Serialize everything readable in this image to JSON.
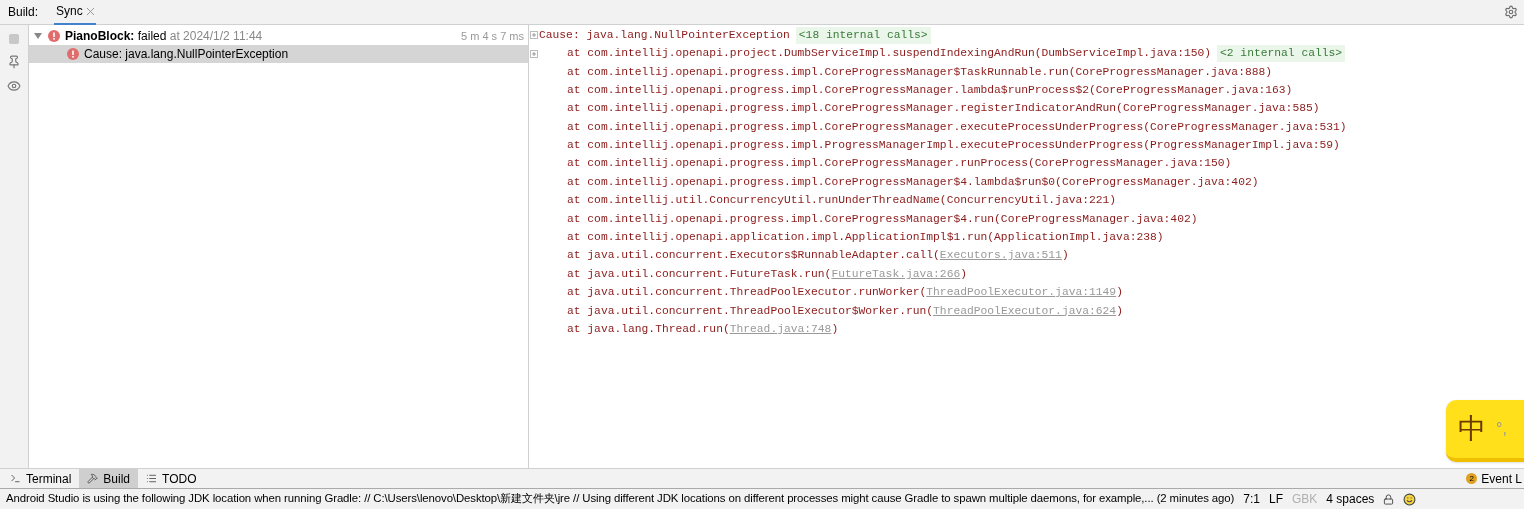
{
  "header": {
    "label": "Build:",
    "tabs": [
      {
        "label": "Sync",
        "selected": true
      }
    ]
  },
  "tree": {
    "items": [
      {
        "name": "PianoBlock:",
        "status": "failed",
        "time": "at 2024/1/2 11:44",
        "duration": "5 m 4 s 7 ms",
        "selected": false,
        "expanded": true,
        "children": [
          {
            "name": "Cause: java.lang.NullPointerException",
            "selected": true
          }
        ]
      }
    ]
  },
  "console": {
    "lines": [
      {
        "kind": "plain",
        "text": "Cause: java.lang.NullPointerException",
        "internal": "<18 internal calls>",
        "fold": true
      },
      {
        "kind": "plain",
        "text": "at com.intellij.openapi.project.DumbServiceImpl.suspendIndexingAndRun(DumbServiceImpl.java:150)",
        "internal": "<2 internal calls>",
        "fold": true
      },
      {
        "kind": "plain",
        "text": "at com.intellij.openapi.progress.impl.CoreProgressManager$TaskRunnable.run(CoreProgressManager.java:888)"
      },
      {
        "kind": "plain",
        "text": "at com.intellij.openapi.progress.impl.CoreProgressManager.lambda$runProcess$2(CoreProgressManager.java:163)"
      },
      {
        "kind": "plain",
        "text": "at com.intellij.openapi.progress.impl.CoreProgressManager.registerIndicatorAndRun(CoreProgressManager.java:585)"
      },
      {
        "kind": "plain",
        "text": "at com.intellij.openapi.progress.impl.CoreProgressManager.executeProcessUnderProgress(CoreProgressManager.java:531)"
      },
      {
        "kind": "plain",
        "text": "at com.intellij.openapi.progress.impl.ProgressManagerImpl.executeProcessUnderProgress(ProgressManagerImpl.java:59)"
      },
      {
        "kind": "plain",
        "text": "at com.intellij.openapi.progress.impl.CoreProgressManager.runProcess(CoreProgressManager.java:150)"
      },
      {
        "kind": "plain",
        "text": "at com.intellij.openapi.progress.impl.CoreProgressManager$4.lambda$run$0(CoreProgressManager.java:402)"
      },
      {
        "kind": "plain",
        "text": "at com.intellij.util.ConcurrencyUtil.runUnderThreadName(ConcurrencyUtil.java:221)"
      },
      {
        "kind": "plain",
        "text": "at com.intellij.openapi.progress.impl.CoreProgressManager$4.run(CoreProgressManager.java:402)"
      },
      {
        "kind": "plain",
        "text": "at com.intellij.openapi.application.impl.ApplicationImpl$1.run(ApplicationImpl.java:238)"
      },
      {
        "kind": "link",
        "prefix": "at java.util.concurrent.Executors$RunnableAdapter.call(",
        "link": "Executors.java:511",
        "suffix": ")"
      },
      {
        "kind": "link",
        "prefix": "at java.util.concurrent.FutureTask.run(",
        "link": "FutureTask.java:266",
        "suffix": ")"
      },
      {
        "kind": "link",
        "prefix": "at java.util.concurrent.ThreadPoolExecutor.runWorker(",
        "link": "ThreadPoolExecutor.java:1149",
        "suffix": ")"
      },
      {
        "kind": "link",
        "prefix": "at java.util.concurrent.ThreadPoolExecutor$Worker.run(",
        "link": "ThreadPoolExecutor.java:624",
        "suffix": ")"
      },
      {
        "kind": "link",
        "prefix": "at java.lang.Thread.run(",
        "link": "Thread.java:748",
        "suffix": ")"
      }
    ]
  },
  "tool_windows": [
    {
      "kind": "terminal",
      "label": "Terminal",
      "selected": false
    },
    {
      "kind": "build",
      "label": "Build",
      "selected": true
    },
    {
      "kind": "todo",
      "label": "TODO",
      "selected": false
    }
  ],
  "event_log": {
    "count": "2",
    "label": "Event L"
  },
  "ime": {
    "mode": "中",
    "punct": "°,"
  },
  "status_bar": {
    "message": "Android Studio is using the following JDK location when running Gradle: // C:\\Users\\lenovo\\Desktop\\新建文件夹\\jre // Using different JDK locations on different processes might cause Gradle to spawn multiple daemons, for example,... (2 minutes ago)",
    "items": [
      {
        "text": "7:1",
        "disabled": false
      },
      {
        "text": "LF",
        "disabled": false
      },
      {
        "text": "GBK",
        "disabled": true
      },
      {
        "text": "4 spaces",
        "disabled": false
      }
    ]
  }
}
